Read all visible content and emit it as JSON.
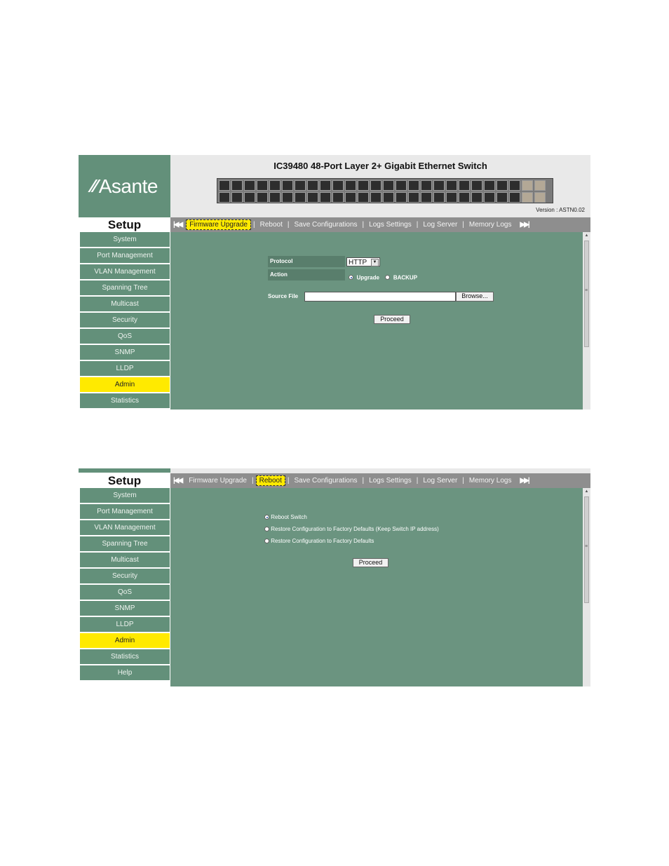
{
  "header": {
    "logo_text": "Asante",
    "title": "IC39480 48-Port Layer 2+ Gigabit Ethernet Switch",
    "version": "Version :  ASTN0.02"
  },
  "nav": {
    "first_icon": "skip-first-icon",
    "last_icon": "skip-last-icon",
    "items": [
      "Firmware Upgrade",
      "Reboot",
      "Save Configurations",
      "Logs Settings",
      "Log Server",
      "Memory Logs"
    ]
  },
  "sidebar": {
    "title": "Setup",
    "items": [
      "System",
      "Port Management",
      "VLAN Management",
      "Spanning Tree",
      "Multicast",
      "Security",
      "QoS",
      "SNMP",
      "LLDP",
      "Admin",
      "Statistics",
      "Help"
    ]
  },
  "firmware": {
    "protocol_label": "Protocol",
    "protocol_value": "HTTP",
    "action_label": "Action",
    "action_upgrade": "Upgrade",
    "action_backup": "BACKUP",
    "source_label": "Source File",
    "source_value": "",
    "browse_label": "Browse...",
    "proceed_label": "Proceed"
  },
  "reboot": {
    "options": [
      "Reboot Switch",
      "Restore Configuration to Factory Defaults  (Keep Switch IP address)",
      "Restore Configuration to Factory Defaults"
    ],
    "proceed_label": "Proceed"
  },
  "colors": {
    "sidebar_green": "#63907a",
    "content_green": "#6b9480",
    "highlight_yellow": "#ffea00",
    "nav_gray": "#8e8e8e"
  }
}
